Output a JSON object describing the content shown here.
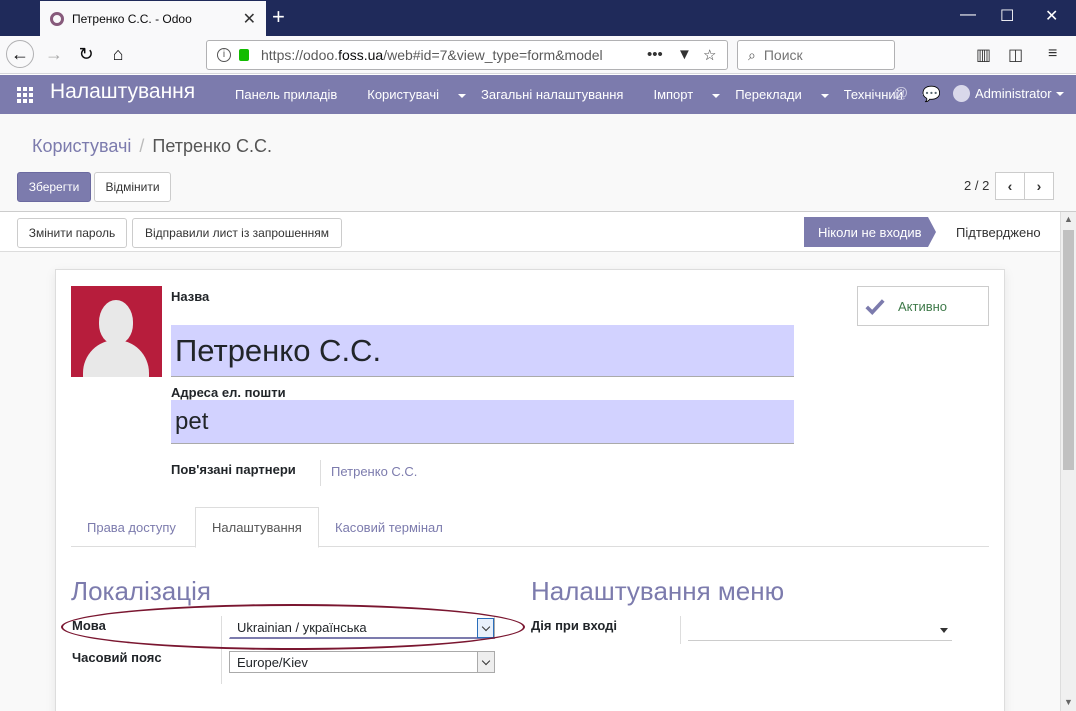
{
  "browser": {
    "tab_title": "Петренко С.С. - Odoo",
    "url_prefix": "https://odoo.",
    "url_domain": "foss.ua",
    "url_suffix": "/web#id=7&view_type=form&model",
    "search_placeholder": "Поиск"
  },
  "odoo": {
    "app_name": "Налаштування",
    "menu": [
      {
        "label": "Панель приладів",
        "dropdown": false
      },
      {
        "label": "Користувачі",
        "dropdown": true
      },
      {
        "label": "Загальні налаштування",
        "dropdown": false
      },
      {
        "label": "Імпорт",
        "dropdown": true
      },
      {
        "label": "Переклади",
        "dropdown": true
      },
      {
        "label": "Технічний",
        "dropdown": true
      }
    ],
    "user": "Administrator"
  },
  "breadcrumb": {
    "parent": "Користувачі",
    "separator": "/",
    "current": "Петренко С.С."
  },
  "actions": {
    "save": "Зберегти",
    "discard": "Відмінити"
  },
  "pager": {
    "value": "2 / 2"
  },
  "header_buttons": {
    "change_password": "Змінити пароль",
    "send_invitation": "Відправили лист із запрошенням"
  },
  "status": {
    "active_stage": "Ніколи не входив",
    "next_stage": "Підтверджено"
  },
  "form": {
    "name_label": "Назва",
    "name_value": "Петренко С.С.",
    "email_label": "Адреса ел. пошти",
    "email_value": "pet",
    "partners_label": "Пов'язані партнери",
    "partners_value": "Петренко С.С.",
    "active_label": "Активно"
  },
  "tabs": [
    "Права доступу",
    "Налаштування",
    "Касовий термінал"
  ],
  "active_tab": "Налаштування",
  "localization": {
    "title": "Локалізація",
    "language_label": "Мова",
    "language_value": "Ukrainian / українська",
    "timezone_label": "Часовий пояс",
    "timezone_value": "Europe/Kiev"
  },
  "menu_settings": {
    "title": "Налаштування меню",
    "home_action_label": "Дія при вході",
    "home_action_value": ""
  },
  "colors": {
    "brand": "#7c7bad",
    "field_bg": "#d2d2ff",
    "highlight_oval": "#7a1630",
    "avatar_bg": "#b71d3c"
  }
}
